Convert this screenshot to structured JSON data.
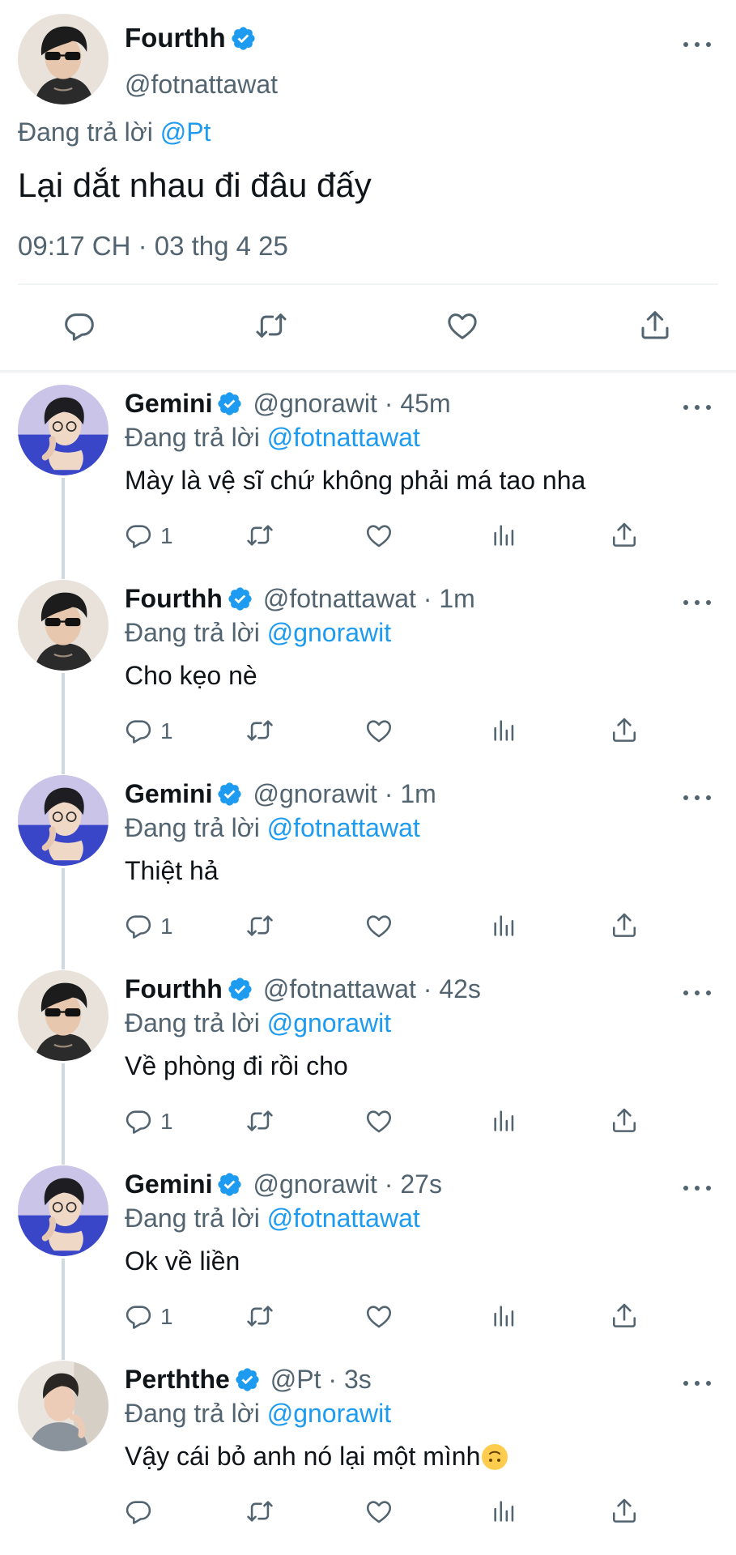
{
  "main_tweet": {
    "name": "Fourthh",
    "handle": "@fotnattawat",
    "replying_prefix": "Đang trả lời",
    "replying_to": "@Pt",
    "text": "Lại dắt nhau đi đâu đấy",
    "timestamp": "09:17 CH · 03 thg 4 25"
  },
  "replies": [
    {
      "name": "Gemini",
      "meta": "@gnorawit · 45m",
      "replying_prefix": "Đang trả lời",
      "replying_to": "@fotnattawat",
      "text": "Mày là vệ sĩ chứ không phải má tao nha",
      "reply_count": "1",
      "avatar": "gemini-avatar"
    },
    {
      "name": "Fourthh",
      "meta": "@fotnattawat · 1m",
      "replying_prefix": "Đang trả lời",
      "replying_to": "@gnorawit",
      "text": "Cho kẹo nè",
      "reply_count": "1",
      "avatar": "fourthh-avatar"
    },
    {
      "name": "Gemini",
      "meta": "@gnorawit · 1m",
      "replying_prefix": "Đang trả lời",
      "replying_to": "@fotnattawat",
      "text": "Thiệt hả",
      "reply_count": "1",
      "avatar": "gemini-avatar"
    },
    {
      "name": "Fourthh",
      "meta": "@fotnattawat · 42s",
      "replying_prefix": "Đang trả lời",
      "replying_to": "@gnorawit",
      "text": "Về phòng đi rồi cho",
      "reply_count": "1",
      "avatar": "fourthh-avatar"
    },
    {
      "name": "Gemini",
      "meta": "@gnorawit · 27s",
      "replying_prefix": "Đang trả lời",
      "replying_to": "@fotnattawat",
      "text": "Ok về liền",
      "reply_count": "1",
      "avatar": "gemini-avatar"
    },
    {
      "name": "Perththe",
      "meta": "@Pt · 3s",
      "replying_prefix": "Đang trả lời",
      "replying_to": "@gnorawit",
      "text": "Vậy cái bỏ anh nó lại một mình",
      "reply_count": "",
      "avatar": "perththe-avatar",
      "emoji": "upside-down-face-emoji"
    }
  ],
  "colors": {
    "accent": "#1d9bf0",
    "text": "#0f1419",
    "secondary": "#536471",
    "divider": "#eff3f4"
  }
}
